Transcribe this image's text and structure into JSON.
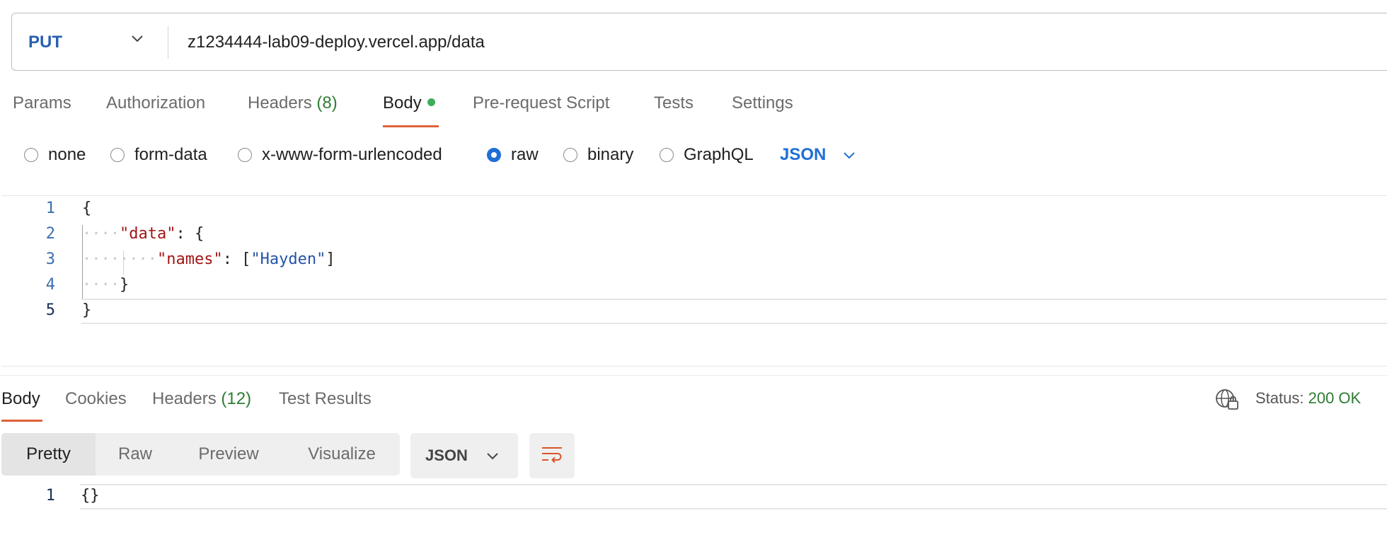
{
  "request": {
    "method": "PUT",
    "url": "z1234444-lab09-deploy.vercel.app/data"
  },
  "request_tabs": [
    {
      "label": "Params"
    },
    {
      "label": "Authorization"
    },
    {
      "label": "Headers",
      "count": "(8)"
    },
    {
      "label": "Body"
    },
    {
      "label": "Pre-request Script"
    },
    {
      "label": "Tests"
    },
    {
      "label": "Settings"
    }
  ],
  "body_types": [
    "none",
    "form-data",
    "x-www-form-urlencoded",
    "raw",
    "binary",
    "GraphQL"
  ],
  "selected_body_type": "raw",
  "raw_language": "JSON",
  "editor": {
    "line_numbers": [
      "1",
      "2",
      "3",
      "4",
      "5"
    ],
    "lines": {
      "l1": "{",
      "l2_key": "\"data\"",
      "l2_rest": ": {",
      "l3_key": "\"names\"",
      "l3_open": ": [",
      "l3_value": "\"Hayden\"",
      "l3_close": "]",
      "l4": "}",
      "l5": "}"
    }
  },
  "response_tabs": [
    {
      "label": "Body"
    },
    {
      "label": "Cookies"
    },
    {
      "label": "Headers",
      "count": "(12)"
    },
    {
      "label": "Test Results"
    }
  ],
  "status": {
    "label": "Status:",
    "value": "200 OK"
  },
  "view_modes": [
    "Pretty",
    "Raw",
    "Preview",
    "Visualize"
  ],
  "response_format": "JSON",
  "response_body": {
    "line_number": "1",
    "text": "{}"
  },
  "colors": {
    "accent": "#1f6fd6",
    "tab_underline": "#e0613a",
    "status_ok": "#2e7d32"
  },
  "icons": [
    "chevron-down-icon",
    "globe-lock-icon",
    "wrap-lines-icon"
  ]
}
